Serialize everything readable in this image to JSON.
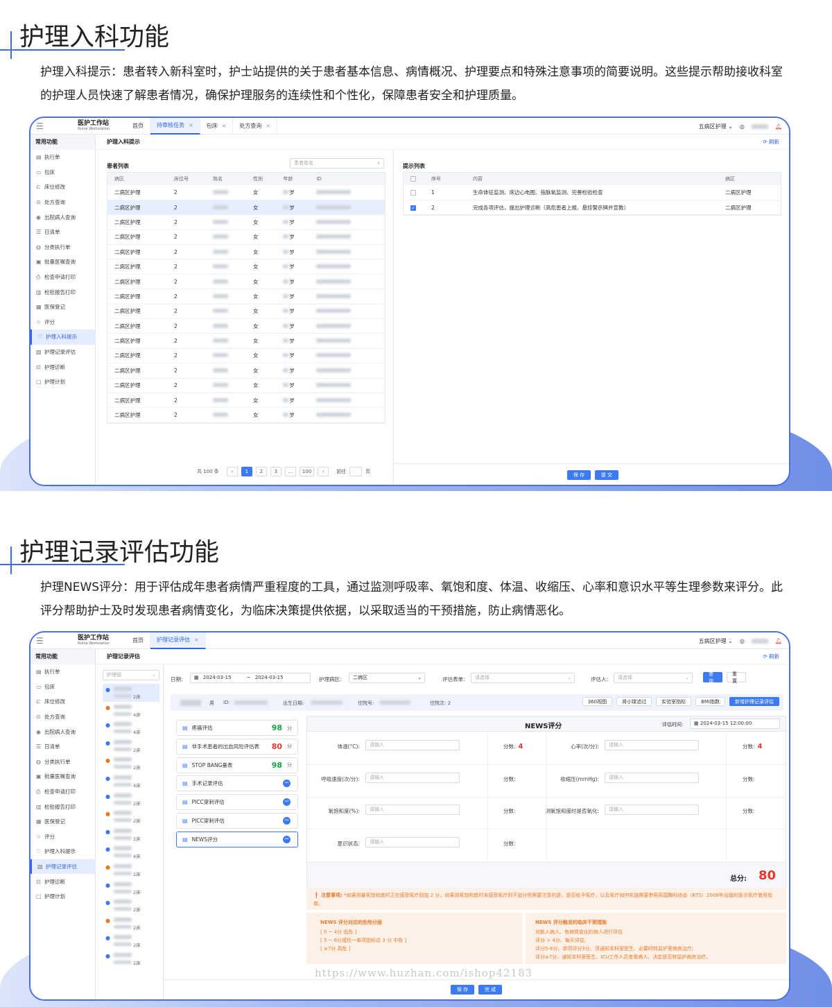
{
  "section1": {
    "title": "护理入科功能",
    "desc": "护理入科提示：患者转入新科室时，护士站提供的关于患者基本信息、病情概况、护理要点和特殊注意事项的简要说明。这些提示帮助接收科室的护理人员快速了解患者情况，确保护理服务的连续性和个性化，保障患者安全和护理质量。"
  },
  "section2": {
    "title": "护理记录评估功能",
    "desc": "护理NEWS评分：用于评估成年患者病情严重程度的工具，通过监测呼吸率、氧饱和度、体温、收缩压、心率和意识水平等生理参数来评分。此评分帮助护士及时发现患者病情变化，为临床决策提供依据，以采取适当的干预措施，防止病情恶化。"
  },
  "app": {
    "logo_main": "医护工作站",
    "logo_sub": "Nurse Workstation",
    "ward_select": "五病区护理",
    "refresh": "刷新",
    "common_functions": "常用功能"
  },
  "win1": {
    "tabs": [
      {
        "label": "首页",
        "closable": false
      },
      {
        "label": "待审核任务",
        "closable": true
      },
      {
        "label": "包床",
        "closable": true
      },
      {
        "label": "处方查询",
        "closable": true
      }
    ],
    "sidebar": [
      {
        "label": "执行单",
        "icon": "doc-icon"
      },
      {
        "label": "包床",
        "icon": "bed-icon"
      },
      {
        "label": "床位修改",
        "icon": "bed-edit-icon"
      },
      {
        "label": "处方查询",
        "icon": "search-icon"
      },
      {
        "label": "出院病人查询",
        "icon": "user-search-icon"
      },
      {
        "label": "日清单",
        "icon": "list-icon"
      },
      {
        "label": "分类执行单",
        "icon": "category-icon"
      },
      {
        "label": "批量医嘱查询",
        "icon": "batch-icon"
      },
      {
        "label": "检查申请打印",
        "icon": "print-icon"
      },
      {
        "label": "检验报告打印",
        "icon": "report-icon"
      },
      {
        "label": "医保登记",
        "icon": "insurance-icon"
      },
      {
        "label": "评分",
        "icon": "star-icon"
      },
      {
        "label": "护理入科提示",
        "icon": "heart-icon"
      },
      {
        "label": "护理记录评估",
        "icon": "record-icon"
      },
      {
        "label": "护理诊断",
        "icon": "diagnosis-icon"
      },
      {
        "label": "护理计划",
        "icon": "plan-icon"
      }
    ],
    "active_side": 12,
    "panel_title": "护理入科提示",
    "patient_list_title": "患者列表",
    "search_placeholder": "患者姓名",
    "patient_columns": [
      "病区",
      "床位号",
      "姓名",
      "性别",
      "年龄",
      "ID"
    ],
    "patient_rows": [
      {
        "ward": "二病区护理",
        "bed": "2",
        "sex": "女",
        "age": "岁"
      },
      {
        "ward": "二病区护理",
        "bed": "2",
        "sex": "女",
        "age": "岁"
      },
      {
        "ward": "二病区护理",
        "bed": "2",
        "sex": "女",
        "age": "岁"
      },
      {
        "ward": "二病区护理",
        "bed": "2",
        "sex": "女",
        "age": "岁"
      },
      {
        "ward": "二病区护理",
        "bed": "2",
        "sex": "女",
        "age": "岁"
      },
      {
        "ward": "二病区护理",
        "bed": "2",
        "sex": "女",
        "age": "岁"
      },
      {
        "ward": "二病区护理",
        "bed": "2",
        "sex": "女",
        "age": "岁"
      },
      {
        "ward": "二病区护理",
        "bed": "2",
        "sex": "女",
        "age": "岁"
      },
      {
        "ward": "二病区护理",
        "bed": "2",
        "sex": "女",
        "age": "岁"
      },
      {
        "ward": "二病区护理",
        "bed": "2",
        "sex": "女",
        "age": "岁"
      },
      {
        "ward": "二病区护理",
        "bed": "2",
        "sex": "女",
        "age": "岁"
      },
      {
        "ward": "二病区护理",
        "bed": "2",
        "sex": "女",
        "age": "岁"
      },
      {
        "ward": "二病区护理",
        "bed": "2",
        "sex": "女",
        "age": "岁"
      },
      {
        "ward": "二病区护理",
        "bed": "2",
        "sex": "女",
        "age": "岁"
      },
      {
        "ward": "二病区护理",
        "bed": "2",
        "sex": "女",
        "age": "岁"
      },
      {
        "ward": "二病区护理",
        "bed": "2",
        "sex": "女",
        "age": "岁"
      }
    ],
    "selected_row": 1,
    "pagination": {
      "total": "共 100 条",
      "pages": [
        "1",
        "2",
        "3",
        "...",
        "100"
      ],
      "current": 0,
      "goto": "前往",
      "page_unit": "页"
    },
    "tips_title": "提示列表",
    "tips_columns": [
      "序号",
      "内容",
      "病区"
    ],
    "tips_rows": [
      {
        "no": "1",
        "content": "生命体征监测、床边心电图、指脉氧监测、完善检验检查",
        "ward": "二病区护理",
        "checked": false
      },
      {
        "no": "2",
        "content": "完成各项评估，提出护理诊断（高危患者上报、悬挂警示牌并宣教）",
        "ward": "二病区护理",
        "checked": true
      }
    ],
    "save": "保 存",
    "submit": "提 交"
  },
  "win2": {
    "tabs": [
      {
        "label": "首页",
        "closable": false
      },
      {
        "label": "护理记录评估",
        "closable": true
      }
    ],
    "active_side": 13,
    "panel_title": "护理记录评估",
    "group_select": "护理组",
    "bed_list": [
      "2床",
      "4床",
      "4床",
      "2床",
      "2床",
      "4床",
      "2床",
      "2床",
      "2床",
      "4床",
      "2床",
      "2床",
      "2床",
      "2床",
      "2床",
      "2床"
    ],
    "filters": {
      "date_label": "日期:",
      "date_from": "2024-03-15",
      "date_sep": "~",
      "date_to": "2024-03-15",
      "ward_label": "护理病区:",
      "ward_value": "二病区",
      "form_label": "评估表单:",
      "form_placeholder": "请选择",
      "assessor_label": "评估人:",
      "assessor_placeholder": "请选择",
      "query": "查询",
      "reset": "重置"
    },
    "patient_bar": {
      "sex": "男",
      "id_label": "ID:",
      "birth_label": "出生日期:",
      "inpatient_label": "住院号:",
      "times_label": "住院次:",
      "times_value": "2",
      "buttons": [
        "360视图",
        "肾小球滤过",
        "实验室指标",
        "BMI指数"
      ],
      "add_button": "新增护理记录评估"
    },
    "assessments": [
      {
        "label": "疼痛评估",
        "score": "98",
        "unit": "分",
        "color": "#1aa34a"
      },
      {
        "label": "非手术患者的出血风险评估表",
        "score": "80",
        "unit": "分",
        "color": "#e03a2f"
      },
      {
        "label": "STOP BANG量表",
        "score": "98",
        "unit": "分",
        "color": "#1aa34a"
      },
      {
        "label": "手术记录评估",
        "score": "",
        "unit": "",
        "color": ""
      },
      {
        "label": "PICC穿刺评估",
        "score": "",
        "unit": "",
        "color": ""
      },
      {
        "label": "PICC穿刺评估",
        "score": "",
        "unit": "",
        "color": ""
      },
      {
        "label": "NEWS评分",
        "score": "",
        "unit": "",
        "color": ""
      }
    ],
    "news": {
      "title": "NEWS评分",
      "time_label": "评估时间:",
      "time_value": "2024-03-15 12:00:00",
      "placeholder": "请输入",
      "score_label": "分数:",
      "fields": [
        {
          "label": "体温(°C):",
          "score": "4"
        },
        {
          "label": "心率(次/分):",
          "score": "4"
        },
        {
          "label": "呼吸速度(次/分):",
          "score": ""
        },
        {
          "label": "收缩压(mmHg):",
          "score": ""
        },
        {
          "label": "氧饱和度(%):",
          "score": ""
        },
        {
          "label": "测氧饱和度时是否氧化:",
          "score": ""
        },
        {
          "label": "意识状态:",
          "score": ""
        }
      ],
      "total_label": "总分:",
      "total_value": "80",
      "notice_label": "注意事项:",
      "notice_text": "*如果测量氧饱和度时正在接受氧疗则加 2 分，如果测氧饱和度时未接受氧疗则不加分但需要注意的是，是否给予氧疗，以及氧疗如何实施需要参照英国胸科协会（BTS）2008年出版的急诊氧疗使用指南。",
      "risk_title": "NEWS 评分对应的危险分层",
      "risk_lines": [
        "[ 0 ~ 4分 低危 ]",
        "[ 5 ~ 6分或任一单项指标达 3 分 中危 ]",
        "[ ≥7分 高危 ]"
      ],
      "action_title": "NEWS 评分触发的临床干预措施",
      "action_lines": [
        "对新入病人、有病情变化的病人进行评估",
        "评分 > 4分、每天评估;",
        "评分5-6分、单项评分3分、须通知本科室医生、必要时转监护室病房治疗;",
        "评分≥7分、通知本科室医生、ICU工作人员查看病人、决定是否转监护病房治疗。"
      ]
    },
    "save": "保 存",
    "finish": "完 成"
  },
  "watermark": "https://www.huzhan.com/ishop42183",
  "colors": {
    "accent": "#3d7bf4",
    "frame": "#4a6fe0",
    "danger": "#e03a2f",
    "success": "#1aa34a",
    "warning": "#e87b2a"
  }
}
